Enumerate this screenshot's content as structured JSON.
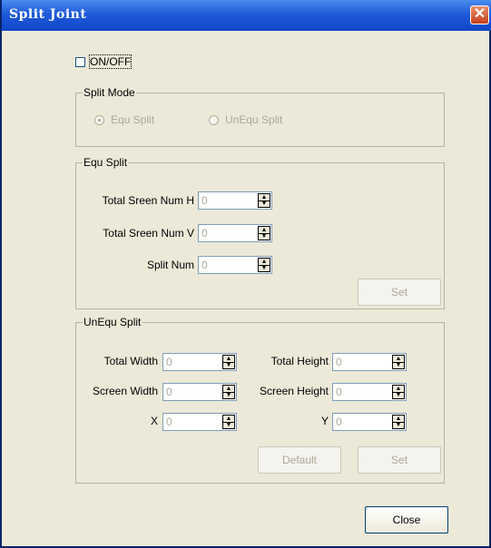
{
  "window": {
    "title": "Split Joint",
    "close_glyph": "✕"
  },
  "onoff": {
    "label": "ON/OFF",
    "checked": false
  },
  "split_mode": {
    "title": "Split Mode",
    "options": [
      {
        "label": "Equ Split",
        "selected": true
      },
      {
        "label": "UnEqu Split",
        "selected": false
      }
    ]
  },
  "equ_split": {
    "title": "Equ Split",
    "fields": [
      {
        "label": "Total Sreen Num H",
        "value": "0"
      },
      {
        "label": "Total Sreen Num V",
        "value": "0"
      },
      {
        "label": "Split Num",
        "value": "0"
      }
    ],
    "set_label": "Set"
  },
  "unequ_split": {
    "title": "UnEqu Split",
    "total_width": {
      "label": "Total Width",
      "value": "0"
    },
    "total_height": {
      "label": "Total Height",
      "value": "0"
    },
    "screen_width": {
      "label": "Screen Width",
      "value": "0"
    },
    "screen_height": {
      "label": "Screen Height",
      "value": "0"
    },
    "x": {
      "label": "X",
      "value": "0"
    },
    "y": {
      "label": "Y",
      "value": "0"
    },
    "default_label": "Default",
    "set_label": "Set"
  },
  "close_label": "Close"
}
